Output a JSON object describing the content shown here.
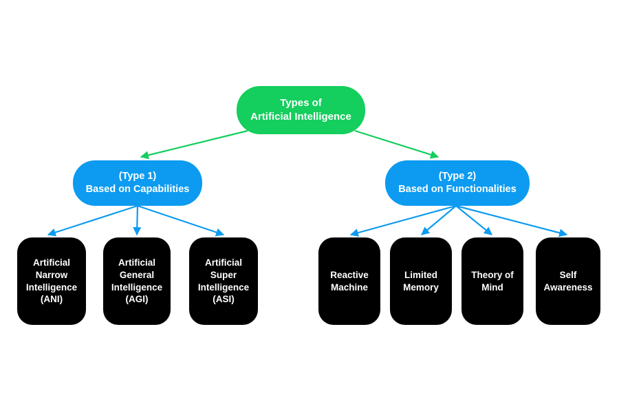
{
  "diagram": {
    "title": "Types of Artificial Intelligence",
    "background_color": "#ffffff",
    "root": {
      "id": "root",
      "label": "Types of\nArtificial Intelligence",
      "color": "#14ce5d",
      "text_color": "#ffffff"
    },
    "categories": [
      {
        "id": "type-1",
        "label": "(Type 1)\nBased on Capabilities",
        "color": "#0c9bf0",
        "text_color": "#ffffff"
      },
      {
        "id": "type-2",
        "label": "(Type 2)\nBased on Functionalities",
        "color": "#0c9bf0",
        "text_color": "#ffffff"
      }
    ],
    "leaves_type_1": [
      {
        "id": "ani",
        "label": "Artificial\nNarrow\nIntelligence\n(ANI)",
        "color": "#000000",
        "text_color": "#ffffff"
      },
      {
        "id": "agi",
        "label": "Artificial\nGeneral\nIntelligence\n(AGI)",
        "color": "#000000",
        "text_color": "#ffffff"
      },
      {
        "id": "asi",
        "label": "Artificial\nSuper\nIntelligence\n(ASI)",
        "color": "#000000",
        "text_color": "#ffffff"
      }
    ],
    "leaves_type_2": [
      {
        "id": "reactive-machine",
        "label": "Reactive\nMachine",
        "color": "#000000",
        "text_color": "#ffffff"
      },
      {
        "id": "limited-memory",
        "label": "Limited\nMemory",
        "color": "#000000",
        "text_color": "#ffffff"
      },
      {
        "id": "theory-of-mind",
        "label": "Theory of\nMind",
        "color": "#000000",
        "text_color": "#ffffff"
      },
      {
        "id": "self-awareness",
        "label": "Self\nAwareness",
        "color": "#000000",
        "text_color": "#ffffff"
      }
    ],
    "edges": {
      "root_edge_color": "#14ce5d",
      "category_edge_color": "#0c9bf0",
      "root_to_categories": [
        {
          "from": "root",
          "to": "type-1"
        },
        {
          "from": "root",
          "to": "type-2"
        }
      ],
      "type_1_to_leaves": [
        {
          "from": "type-1",
          "to": "ani"
        },
        {
          "from": "type-1",
          "to": "agi"
        },
        {
          "from": "type-1",
          "to": "asi"
        }
      ],
      "type_2_to_leaves": [
        {
          "from": "type-2",
          "to": "reactive-machine"
        },
        {
          "from": "type-2",
          "to": "limited-memory"
        },
        {
          "from": "type-2",
          "to": "theory-of-mind"
        },
        {
          "from": "type-2",
          "to": "self-awareness"
        }
      ]
    }
  }
}
